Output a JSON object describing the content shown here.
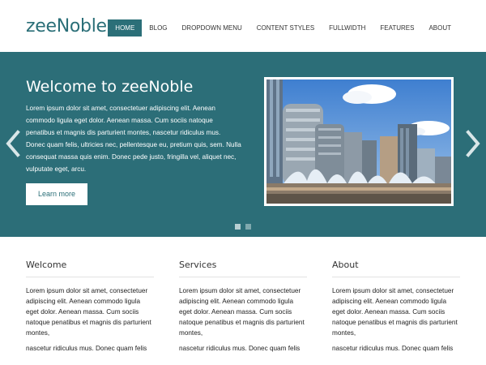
{
  "site": {
    "logo": "zeeNoble"
  },
  "nav": {
    "items": [
      {
        "label": "HOME"
      },
      {
        "label": "BLOG"
      },
      {
        "label": "DROPDOWN MENU"
      },
      {
        "label": "CONTENT STYLES"
      },
      {
        "label": "FULLWIDTH"
      },
      {
        "label": "FEATURES"
      },
      {
        "label": "ABOUT"
      }
    ],
    "active_index": 0
  },
  "slider": {
    "title": "Welcome to zeeNoble",
    "text": "Lorem ipsum dolor sit amet, consectetuer adipiscing elit. Aenean commodo ligula eget dolor. Aenean massa. Cum sociis natoque penatibus et magnis dis parturient montes, nascetur ridiculus mus. Donec quam felis, ultricies nec, pellentesque eu, pretium quis, sem. Nulla consequat massa quis enim. Donec pede justo, fringilla vel, aliquet nec, vulputate eget, arcu.",
    "button": "Learn more",
    "slide_count": 2,
    "active_slide": 1
  },
  "columns": [
    {
      "title": "Welcome",
      "text": "Lorem ipsum dolor sit amet, consectetuer adipiscing elit. Aenean commodo ligula eget dolor. Aenean massa. Cum sociis natoque penatibus et magnis dis parturient montes,",
      "text2": "nascetur ridiculus mus. Donec quam felis"
    },
    {
      "title": "Services",
      "text": "Lorem ipsum dolor sit amet, consectetuer adipiscing elit. Aenean commodo ligula eget dolor. Aenean massa. Cum sociis natoque penatibus et magnis dis parturient montes,",
      "text2": "nascetur ridiculus mus. Donec quam felis"
    },
    {
      "title": "About",
      "text": "Lorem ipsum dolor sit amet, consectetuer adipiscing elit. Aenean commodo ligula eget dolor. Aenean massa. Cum sociis natoque penatibus et magnis dis parturient montes,",
      "text2": "nascetur ridiculus mus. Donec quam felis"
    }
  ],
  "colors": {
    "accent": "#2b6f78",
    "slider_bg": "#2c6e78"
  }
}
